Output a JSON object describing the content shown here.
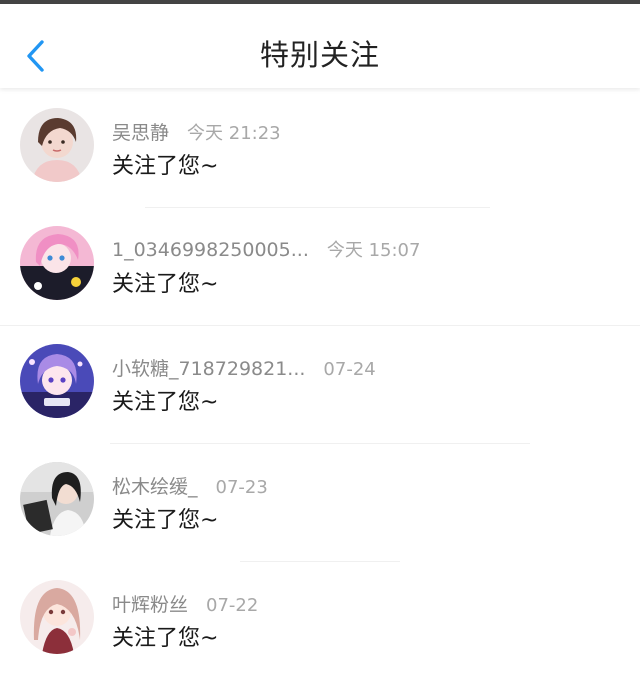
{
  "header": {
    "title": "特别关注",
    "back_icon": "chevron-left-icon",
    "accent": "#2196f3"
  },
  "messages": [
    {
      "name": "吴思静",
      "time": "今天 21:23",
      "text": "关注了您~"
    },
    {
      "name": "1_0346998250005...",
      "time": "今天 15:07",
      "text": "关注了您~"
    },
    {
      "name": "小软糖_718729821...",
      "time": "07-24",
      "text": "关注了您~"
    },
    {
      "name": "松木绘缓_",
      "time": "07-23",
      "text": "关注了您~"
    },
    {
      "name": "叶辉粉丝",
      "time": "07-22",
      "text": "关注了您~"
    }
  ]
}
